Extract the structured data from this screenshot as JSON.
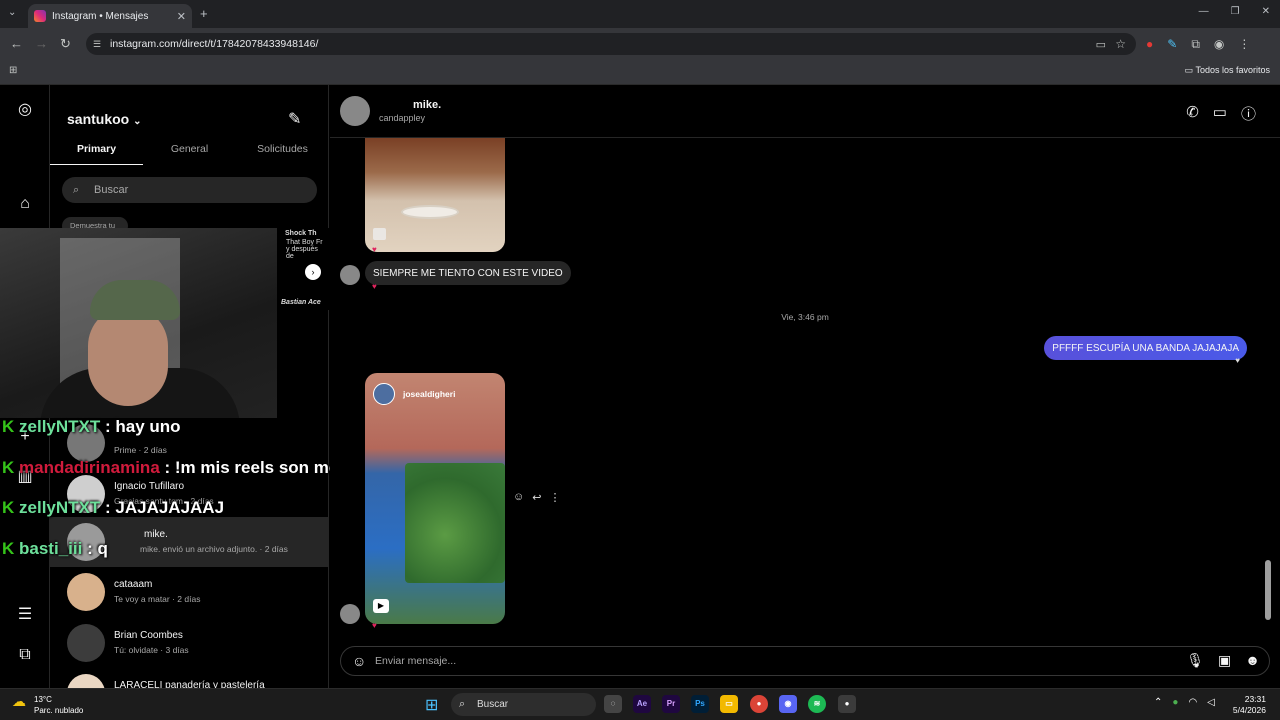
{
  "browser": {
    "tab_title": "Instagram • Mensajes",
    "url": "instagram.com/direct/t/17842078433948146/",
    "bookmarks_folder": "Todos los favoritos"
  },
  "inbox": {
    "username": "santukoo",
    "tabs": [
      "Primary",
      "General",
      "Solicitudes"
    ],
    "search_placeholder": "Buscar",
    "note_text": "Demuestra tu",
    "conversations": [
      {
        "name": "",
        "preview": "Prime · 2 días"
      },
      {
        "name": "Ignacio Tufillaro",
        "preview": "Gracias santu tqm · 2 días"
      },
      {
        "name": "mike.",
        "preview": "mike. envió un archivo adjunto. · 2 días"
      },
      {
        "name": "cataaam",
        "preview": "Te voy a matar · 2 días"
      },
      {
        "name": "Brian Coombes",
        "preview": "Tú: olvidate · 3 días"
      },
      {
        "name": "LARACELI panadería y pastelería",
        "preview": ""
      }
    ]
  },
  "overlay": {
    "ad_title": "Shock Th",
    "ad_line1": "That Boy Fr",
    "ad_line2": "y después de",
    "ad_brand": "Bastian Ace",
    "chat": [
      {
        "badge": "K",
        "user": "zellyNTXT",
        "text": ": hay uno"
      },
      {
        "badge": "K",
        "user": "mandadirinamina",
        "text": ": !m mis reels son mejores"
      },
      {
        "badge": "K",
        "user": "zellyNTXT",
        "text": ": JAJAJAJAAJ"
      },
      {
        "badge": "K",
        "user": "basti_iii",
        "text": ": q"
      }
    ]
  },
  "thread": {
    "contact_name": "mike.",
    "contact_handle": "candappley",
    "incoming_message": "SIEMPRE ME TIENTO CON ESTE VIDEO",
    "timestamp": "Vie, 3:46 pm",
    "outgoing_message": "PFFFF ESCUPÍA UNA BANDA JAJAJAJA",
    "reel_author": "josealdigheri",
    "composer_placeholder": "Enviar mensaje..."
  },
  "taskbar": {
    "temperature": "13°C",
    "weather": "Parc. nublado",
    "search_label": "Buscar",
    "time": "23:31",
    "date": "5/4/2026"
  }
}
